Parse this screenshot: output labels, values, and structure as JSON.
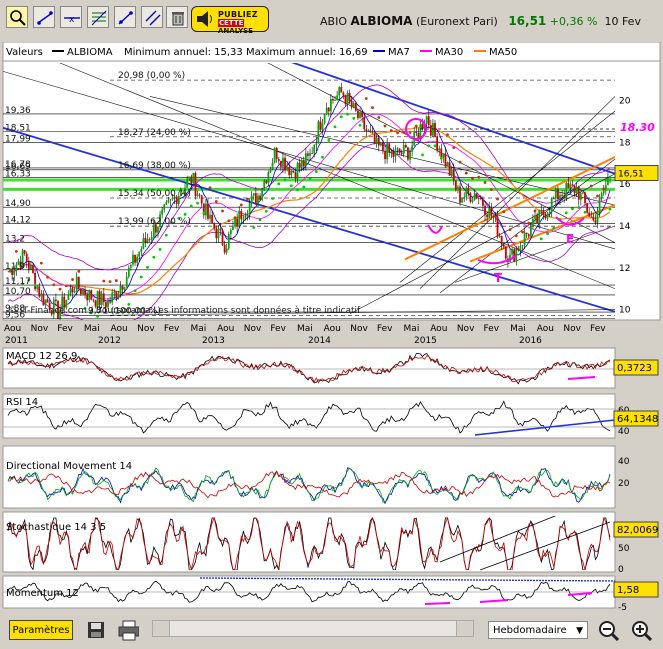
{
  "header": {
    "ticker": "ABIO",
    "name": "ALBIOMA",
    "exchange": "(Euronext Pari)",
    "price": "16,51",
    "change": "+0,36 %",
    "date": "10 Fev"
  },
  "publicity": {
    "line1": "PUBLIEZ",
    "line2a": "CETTE",
    "line2b": "ANALYSE"
  },
  "toolbar": {
    "items": [
      "zoom-icon",
      "line-draw-icon",
      "horizontal-line-icon",
      "fibonacci-icon",
      "channel-icon",
      "parallel-icon",
      "trash-icon"
    ]
  },
  "legend": {
    "valeurs": "Valeurs",
    "albioma": "ALBIOMA",
    "minmax": "Minimum annuel: 15,33 Maximum annuel: 16,69",
    "ma7": "MA7",
    "ma30": "MA30",
    "ma50": "MA50",
    "ma7_color": "#0000cc",
    "ma30_color": "#ff00ff",
    "ma50_color": "#ff8000"
  },
  "chart_data": [
    {
      "type": "line",
      "title": "ALBIOMA",
      "x_labels": [
        "Aou",
        "Nov",
        "Fev",
        "Mai",
        "Aou",
        "Nov",
        "Fev",
        "Mai",
        "Aou",
        "Nov",
        "Fev",
        "Mai",
        "Aou",
        "Nov",
        "Fev",
        "Mai",
        "Aou",
        "Nov",
        "Fev",
        "Mai",
        "Aou",
        "Nov",
        "Fev"
      ],
      "year_labels": [
        "2011",
        "2012",
        "2013",
        "2014",
        "2015",
        "2016"
      ],
      "y_ticks": [
        "10",
        "12",
        "14",
        "16",
        "18",
        "20"
      ],
      "ylim": [
        9.5,
        21.8
      ],
      "price": [
        11.8,
        12.6,
        10.6,
        9.9,
        11.2,
        10.6,
        10.3,
        11.5,
        13.0,
        14.2,
        15.4,
        16.3,
        14.3,
        13.1,
        14.7,
        15.5,
        17.6,
        16.6,
        17.2,
        19.8,
        20.4,
        19.1,
        17.8,
        17.4,
        17.6,
        19.3,
        17.4,
        15.4,
        15.6,
        14.4,
        12.4,
        13.6,
        14.6,
        15.6,
        15.8,
        14.2,
        16.5
      ],
      "fib_levels": [
        {
          "label": "20,98 (0,00 %)",
          "value": 20.98
        },
        {
          "label": "18,27 (24,00 %)",
          "value": 18.27
        },
        {
          "label": "16,69 (38,00 %)",
          "value": 16.69
        },
        {
          "label": "15,34 (50,00 %)",
          "value": 15.34
        },
        {
          "label": "13,99 (62,00 %)",
          "value": 13.99
        },
        {
          "label": "9,71 (100,00 %)",
          "value": 9.71
        }
      ],
      "left_levels": [
        "19,36",
        "18,51",
        "17,99",
        "16,78",
        "16,69",
        "16,33",
        "14,90",
        "14,12",
        "13,2",
        "11,9",
        "11,17",
        "10,70",
        "9,88",
        "9,56"
      ],
      "annotations": [
        "18.30",
        "T",
        "E"
      ],
      "last_value": "16,51",
      "watermark": "© IT-Finance.com / Boursorama Les informations sont données à titre indicatif"
    },
    {
      "type": "line",
      "title": "MACD 12 26 9",
      "last_value": "0,3723"
    },
    {
      "type": "line",
      "title": "RSI 14",
      "last_value": "64,1348",
      "y_ticks": [
        "60",
        "40"
      ]
    },
    {
      "type": "line",
      "title": "Directional Movement 14",
      "y_ticks": [
        "40",
        "20"
      ]
    },
    {
      "type": "line",
      "title": "Stochastique 14 3 5",
      "last_value": "82,0069",
      "y_ticks": [
        "50",
        "0"
      ]
    },
    {
      "type": "line",
      "title": "Momentum 12",
      "last_value": "1,58",
      "y_ticks": [
        "0",
        "-5"
      ]
    }
  ],
  "bottom": {
    "params_label": "Paramètres",
    "period": "Hebdomadaire"
  }
}
